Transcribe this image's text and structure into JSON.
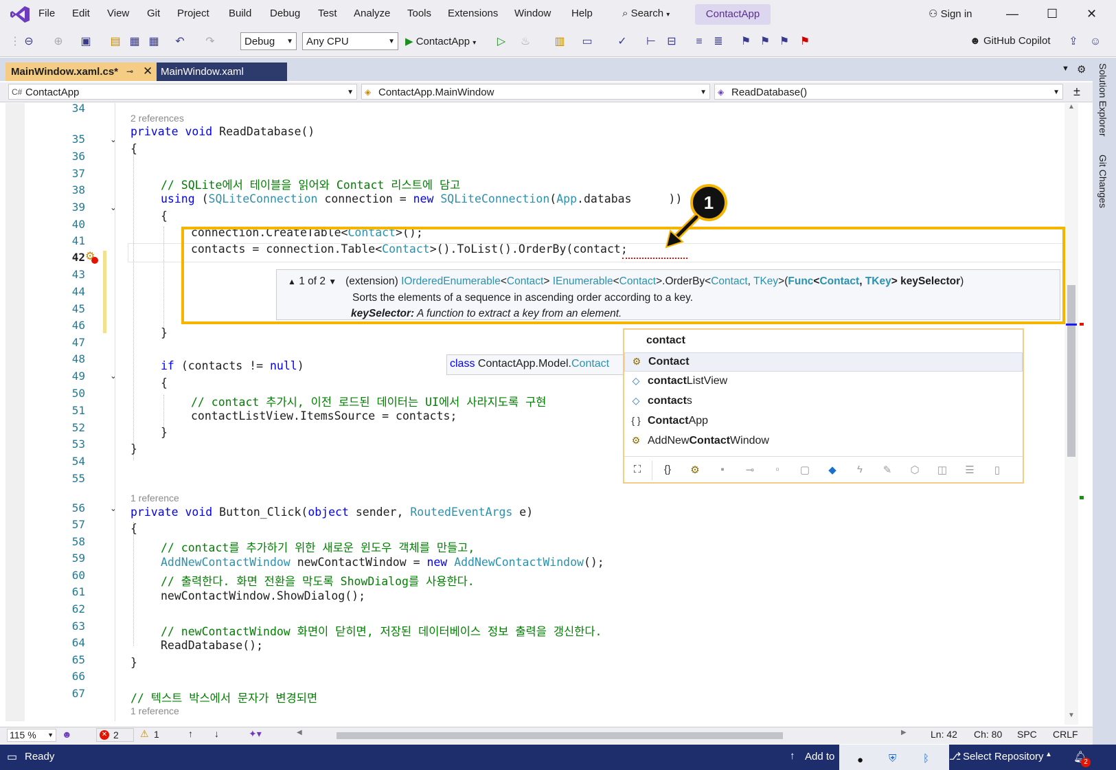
{
  "menu": [
    "File",
    "Edit",
    "View",
    "Git",
    "Project",
    "Build",
    "Debug",
    "Test",
    "Analyze",
    "Tools",
    "Extensions",
    "Window",
    "Help"
  ],
  "search_label": "Search",
  "project_chip": "ContactApp",
  "sign_in": "Sign in",
  "toolbar": {
    "config": "Debug",
    "platform": "Any CPU",
    "run_label": "ContactApp",
    "copilot": "GitHub Copilot"
  },
  "tabs": [
    {
      "label": "MainWindow.xaml.cs*",
      "active": true
    },
    {
      "label": "MainWindow.xaml",
      "active": false
    }
  ],
  "nav": {
    "project": "ContactApp",
    "type": "ContactApp.MainWindow",
    "member": "ReadDatabase()"
  },
  "side_panels": [
    "Solution Explorer",
    "Git Changes"
  ],
  "line_numbers": [
    "34",
    "35",
    "36",
    "37",
    "38",
    "39",
    "40",
    "41",
    "42",
    "43",
    "44",
    "45",
    "46",
    "47",
    "48",
    "49",
    "50",
    "51",
    "52",
    "53",
    "54",
    "55",
    "56",
    "57",
    "58",
    "59",
    "60",
    "61",
    "62",
    "63",
    "64",
    "65",
    "66",
    "67"
  ],
  "code": {
    "ref_2": "2 references",
    "l35_kw1": "private",
    "l35_kw2": "void",
    "l35_rest": "ReadDatabase()",
    "l36": "{",
    "l38": "// SQLite에서 테이블을 읽어와 Contact 리스트에 담고",
    "l39_kw": "using",
    "l39_a": "(",
    "l39_t1": "SQLiteConnection",
    "l39_b": "connection =",
    "l39_kw2": "new",
    "l39_t2": "SQLiteConnection",
    "l39_c": "(",
    "l39_t3": "App",
    "l39_d": ".databas",
    "l39_e": "))",
    "l40": "{",
    "l41_a": "connection.CreateTable<",
    "l41_t": "Contact",
    "l41_b": ">();",
    "l42_a": "contacts = connection.Table<",
    "l42_t": "Contact",
    "l42_b": ">().ToList().OrderBy(contact;",
    "l47": "}",
    "l49_kw": "if",
    "l49_a": "(contacts !=",
    "l49_kw2": "null",
    "l49_b": ")",
    "l50": "{",
    "l51": "// contact 추가시, 이전 로드된 데이터는 UI에서 사라지도록 구현",
    "l52": "contactListView.ItemsSource = contacts;",
    "l53": "}",
    "l54": "}",
    "ref_1": "1 reference",
    "l56_kw1": "private",
    "l56_kw2": "void",
    "l56_a": "Button_Click(",
    "l56_kw3": "object",
    "l56_b": "sender,",
    "l56_t": "RoutedEventArgs",
    "l56_c": "e)",
    "l57": "{",
    "l58": "// contact를 추가하기 위한 새로운 윈도우 객체를 만들고,",
    "l59_t1": "AddNewContactWindow",
    "l59_a": "newContactWindow =",
    "l59_kw": "new",
    "l59_t2": "AddNewContactWindow",
    "l59_b": "();",
    "l60": "// 출력한다. 화면 전환을 막도록 ShowDialog를 사용한다.",
    "l61": "newContactWindow.ShowDialog();",
    "l63": "// newContactWindow 화면이 닫히면, 저장된 데이터베이스 정보 출력을 갱신한다.",
    "l64": "ReadDatabase();",
    "l65": "}",
    "l67": "// 텍스트 박스에서 문자가 변경되면",
    "ref_1b": "1 reference"
  },
  "signature": {
    "counter": "1 of 2",
    "prefix": "(extension)",
    "t1": "IOrderedEnumerable",
    "lt1": "<",
    "t2": "Contact",
    "gt1": ">",
    "t3": "IEnumerable",
    "lt2": "<",
    "t4": "Contact",
    "gt2": ">.OrderBy<",
    "t5": "Contact",
    "comma": ",",
    "t6": "TKey",
    "gt3": ">(",
    "t7": "Func",
    "lt3": "<",
    "t8": "Contact",
    "comma2": ",",
    "t9": "TKey",
    "gt4": ">",
    "param": "keySelector",
    "close": ")",
    "desc": "Sorts the elements of a sequence in ascending order according to a key.",
    "param_label": "keySelector:",
    "param_desc": "A function to extract a key from an element."
  },
  "callout": "1",
  "classtip": {
    "kw": "class",
    "a": "ContactApp.Model.",
    "t": "Contact"
  },
  "completion": {
    "header": "contact",
    "items": [
      {
        "bold": "Contact",
        "rest": "",
        "icon": "class-icon"
      },
      {
        "bold": "contact",
        "rest": "ListView",
        "icon": "field-icon"
      },
      {
        "bold": "contact",
        "rest": "s",
        "icon": "field-icon"
      },
      {
        "bold": "Contact",
        "rest": "App",
        "icon": "namespace-icon"
      },
      {
        "pre": "AddNew",
        "bold": "Contact",
        "rest": "Window",
        "icon": "class-icon"
      }
    ]
  },
  "edstatus": {
    "zoom": "115 %",
    "errors": "2",
    "warnings": "1",
    "ln": "Ln: 42",
    "ch": "Ch: 80",
    "spc": "SPC",
    "crlf": "CRLF"
  },
  "statusbar": {
    "ready": "Ready",
    "add_to": "Add to",
    "select_repo": "Select Repository",
    "notif_count": "2"
  }
}
